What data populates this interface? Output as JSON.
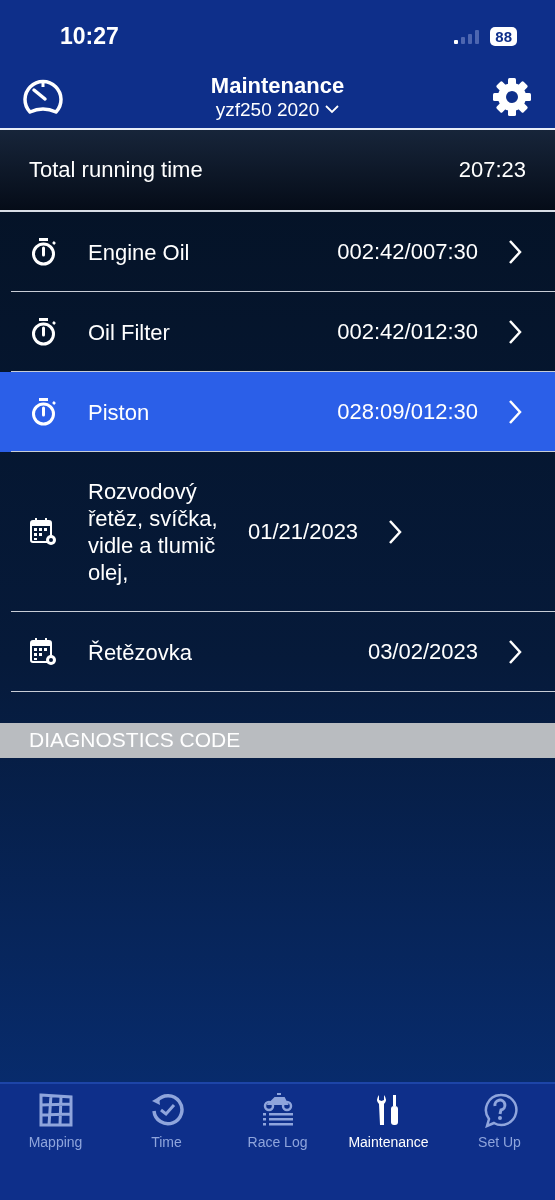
{
  "status_bar": {
    "time": "10:27",
    "battery": "88"
  },
  "header": {
    "title": "Maintenance",
    "subtitle": "yzf250 2020"
  },
  "total": {
    "label": "Total running time",
    "value": "207:23"
  },
  "items": [
    {
      "kind": "timer",
      "name": "Engine Oil",
      "value": "002:42/007:30",
      "selected": false
    },
    {
      "kind": "timer",
      "name": "Oil Filter",
      "value": "002:42/012:30",
      "selected": false
    },
    {
      "kind": "timer",
      "name": "Piston",
      "value": "028:09/012:30",
      "selected": true
    },
    {
      "kind": "schedule",
      "name": "Rozvodový řetěz, svíčka, vidle a tlumič olej,",
      "value": "01/21/2023",
      "selected": false
    },
    {
      "kind": "schedule",
      "name": "Řetězovka",
      "value": "03/02/2023",
      "selected": false
    }
  ],
  "diagnostics": {
    "title": "DIAGNOSTICS CODE"
  },
  "tabs": [
    {
      "kind": "map",
      "label": "Mapping",
      "selected": false
    },
    {
      "kind": "time",
      "label": "Time",
      "selected": false
    },
    {
      "kind": "racelog",
      "label": "Race Log",
      "selected": false
    },
    {
      "kind": "tools",
      "label": "Maintenance",
      "selected": true
    },
    {
      "kind": "help",
      "label": "Set Up",
      "selected": false
    }
  ]
}
